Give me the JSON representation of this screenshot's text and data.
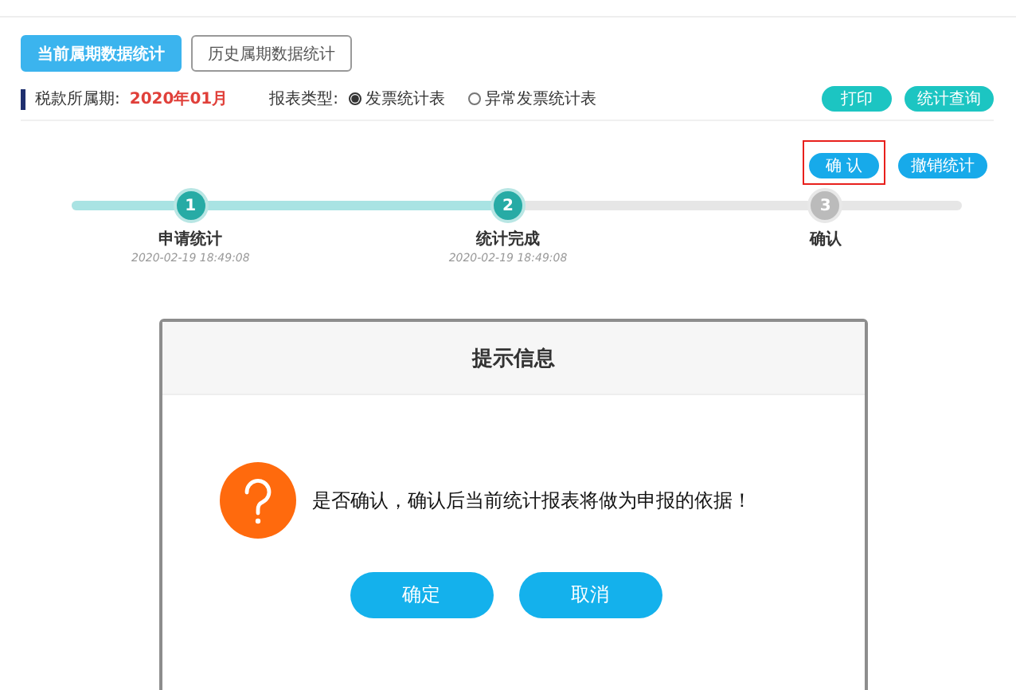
{
  "tabs": [
    {
      "label": "当前属期数据统计",
      "selected": true
    },
    {
      "label": "历史属期数据统计",
      "selected": false
    }
  ],
  "period": {
    "label": "税款所属期:",
    "value": "2020年01月"
  },
  "report_type": {
    "label": "报表类型:",
    "options": [
      {
        "label": "发票统计表",
        "selected": true
      },
      {
        "label": "异常发票统计表",
        "selected": false
      }
    ]
  },
  "top_buttons": [
    "打印",
    "统计查询"
  ],
  "action_buttons": [
    {
      "label": "确 认",
      "highlighted": true
    },
    {
      "label": "撤销统计",
      "highlighted": false
    }
  ],
  "steps": [
    {
      "number": "1",
      "label": "申请统计",
      "time": "2020-02-19 18:49:08",
      "done": true
    },
    {
      "number": "2",
      "label": "统计完成",
      "time": "2020-02-19 18:49:08",
      "done": true
    },
    {
      "number": "3",
      "label": "确认",
      "done": false
    }
  ],
  "dialog": {
    "title": "提示信息",
    "message": "是否确认，确认后当前统计报表将做为申报的依据！",
    "buttons": [
      "确定",
      "取消"
    ]
  }
}
